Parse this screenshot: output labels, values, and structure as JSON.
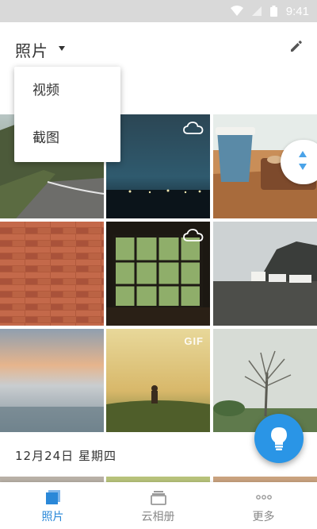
{
  "status_bar": {
    "time": "9:41"
  },
  "app_bar": {
    "title": "照片",
    "title_icon": "dropdown-caret",
    "action_icon": "pencil-edit"
  },
  "dropdown_menu": {
    "items": [
      "视频",
      "截图"
    ]
  },
  "grid": {
    "badges": {
      "gif": "GIF"
    },
    "tiles": [
      {
        "subject": "mountain road",
        "badge": ""
      },
      {
        "subject": "night city skyline",
        "badge": "cloud"
      },
      {
        "subject": "coffee cup and cookies",
        "badge": ""
      },
      {
        "subject": "brick wall",
        "badge": ""
      },
      {
        "subject": "window with plants",
        "badge": "cloud"
      },
      {
        "subject": "cliff with houses",
        "badge": ""
      },
      {
        "subject": "foggy sunset sea",
        "badge": ""
      },
      {
        "subject": "person in golden field",
        "badge": "GIF"
      },
      {
        "subject": "bare tree",
        "badge": ""
      }
    ]
  },
  "section": {
    "date_label": "12月24日  星期四"
  },
  "fab": {
    "icon": "lightbulb"
  },
  "bottom_nav": {
    "items": [
      {
        "label": "照片",
        "icon": "photos",
        "active": true
      },
      {
        "label": "云相册",
        "icon": "cloud-album",
        "active": false
      },
      {
        "label": "更多",
        "icon": "more-dots",
        "active": false
      }
    ]
  },
  "colors": {
    "accent": "#2a95e6",
    "active_nav": "#2a88d8",
    "status_bar": "#d9d9d9"
  }
}
